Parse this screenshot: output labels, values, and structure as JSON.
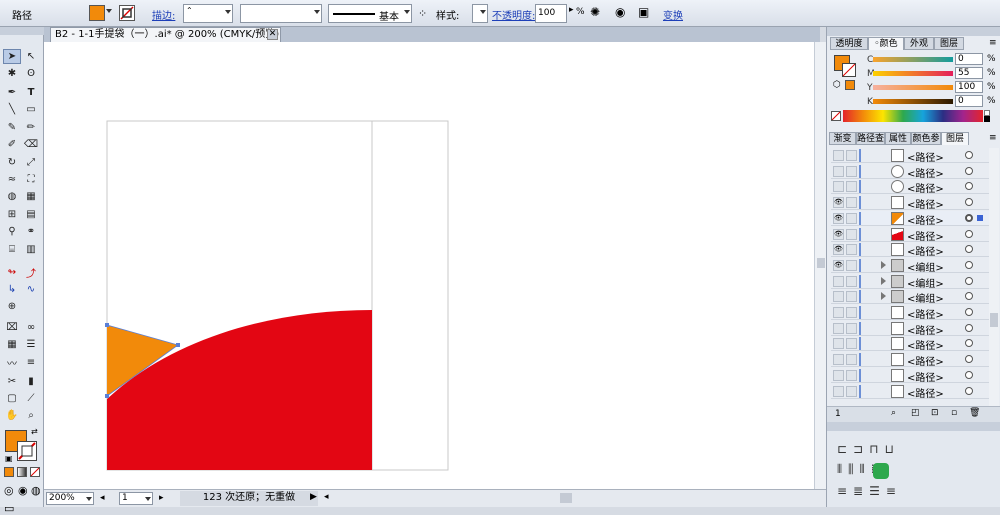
{
  "control_bar": {
    "object_type": "路径",
    "fill_color": "#f28a0a",
    "stroke_label": "描边:",
    "stroke_weight": "",
    "brush_style": "基本",
    "style_label": "样式:",
    "opacity_label": "不透明度:",
    "opacity_value": "100",
    "opacity_unit": "%",
    "transform_label": "变换"
  },
  "document_tab": {
    "title": "B2 - 1-1手提袋（一）.ai* @ 200% (CMYK/预览)",
    "close_glyph": "✕"
  },
  "toolbox": {
    "fill_color": "#f28a0a",
    "tools": [
      "selection",
      "direct-selection",
      "magic-wand",
      "lasso",
      "pen",
      "type",
      "line",
      "rectangle",
      "paintbrush",
      "pencil",
      "blob-brush",
      "eraser",
      "rotate",
      "scale",
      "warp",
      "free-transform",
      "shape-builder",
      "perspective",
      "mesh",
      "gradient",
      "eyedropper",
      "blend",
      "symbol-sprayer",
      "column-graph",
      "artboard",
      "slice",
      "hand",
      "zoom"
    ]
  },
  "artwork": {
    "red_color": "#e30613",
    "orange_color": "#f28a0a"
  },
  "status_bar": {
    "zoom": "200%",
    "artboard_number": "1",
    "history": "123 次还原；无重做"
  },
  "color_panel": {
    "tabs": [
      "透明度",
      "颜色",
      "外观",
      "图层"
    ],
    "active_tab": "颜色",
    "fill_color": "#f28a0a",
    "channels": [
      {
        "label": "C",
        "value": "0",
        "unit": "%"
      },
      {
        "label": "M",
        "value": "55",
        "unit": "%"
      },
      {
        "label": "Y",
        "value": "100",
        "unit": "%"
      },
      {
        "label": "K",
        "value": "0",
        "unit": "%"
      }
    ]
  },
  "layers_panel": {
    "tabs": [
      "渐变",
      "路径查",
      "属性",
      "颜色参",
      "图层"
    ],
    "active_tab": "图层",
    "rows": [
      {
        "name": "<路径>",
        "visible": false,
        "thumb": "white",
        "expand": false
      },
      {
        "name": "<路径>",
        "visible": false,
        "thumb": "circle",
        "expand": false
      },
      {
        "name": "<路径>",
        "visible": false,
        "thumb": "circle",
        "expand": false
      },
      {
        "name": "<路径>",
        "visible": true,
        "thumb": "white",
        "expand": false
      },
      {
        "name": "<路径>",
        "visible": true,
        "thumb": "orange",
        "expand": false,
        "selected": true
      },
      {
        "name": "<路径>",
        "visible": true,
        "thumb": "red",
        "expand": false
      },
      {
        "name": "<路径>",
        "visible": true,
        "thumb": "white",
        "expand": false
      },
      {
        "name": "<编组>",
        "visible": true,
        "thumb": "group",
        "expand": true
      },
      {
        "name": "<编组>",
        "visible": false,
        "thumb": "group",
        "expand": true
      },
      {
        "name": "<编组>",
        "visible": false,
        "thumb": "group",
        "expand": true
      },
      {
        "name": "<路径>",
        "visible": false,
        "thumb": "white",
        "expand": false
      },
      {
        "name": "<路径>",
        "visible": false,
        "thumb": "white",
        "expand": false
      },
      {
        "name": "<路径>",
        "visible": false,
        "thumb": "white",
        "expand": false
      },
      {
        "name": "<路径>",
        "visible": false,
        "thumb": "white",
        "expand": false
      },
      {
        "name": "<路径>",
        "visible": false,
        "thumb": "white",
        "expand": false
      },
      {
        "name": "<路径>",
        "visible": false,
        "thumb": "white",
        "expand": false
      }
    ],
    "footer_count": "1"
  }
}
